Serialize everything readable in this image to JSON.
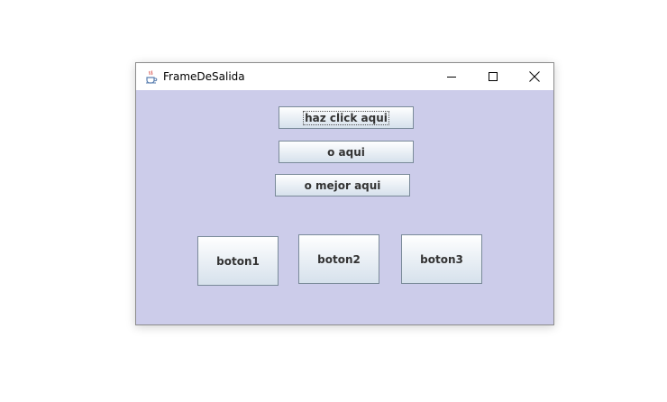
{
  "window": {
    "title": "FrameDeSalida",
    "app_icon": "java-coffee-cup-icon",
    "controls": {
      "minimize_icon": "minimize-icon",
      "maximize_icon": "maximize-icon",
      "close_icon": "close-icon"
    }
  },
  "content": {
    "background": "#ccccea",
    "buttons": [
      {
        "label": "haz click aqui",
        "focused": true
      },
      {
        "label": "o aqui"
      },
      {
        "label": "o mejor aqui"
      },
      {
        "label": "boton1"
      },
      {
        "label": "boton2"
      },
      {
        "label": "boton3"
      }
    ]
  }
}
